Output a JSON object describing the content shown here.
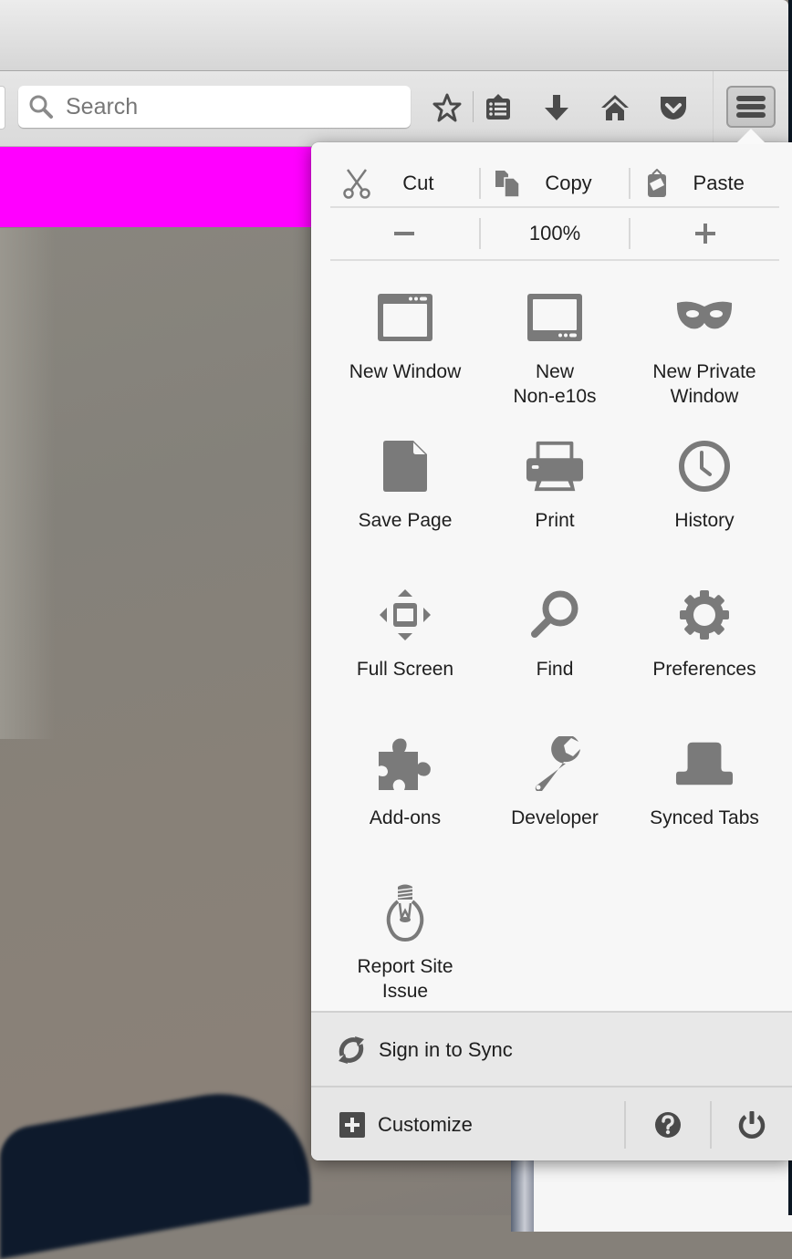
{
  "colors": {
    "icon_gray": "#7a7a7a",
    "icon_dark": "#4a4a4a",
    "page_banner": "#ff00ff"
  },
  "toolbar": {
    "search": {
      "placeholder": "Search",
      "value": "",
      "icon": "search-icon"
    },
    "buttons": [
      {
        "name": "bookmark",
        "icon": "star-icon"
      },
      {
        "name": "bookmarks-menu",
        "icon": "bookmarks-list-icon"
      },
      {
        "name": "downloads",
        "icon": "download-arrow-icon"
      },
      {
        "name": "home",
        "icon": "home-icon"
      },
      {
        "name": "pocket",
        "icon": "pocket-icon"
      },
      {
        "name": "open-menu",
        "icon": "hamburger-icon",
        "active": true
      }
    ]
  },
  "panel": {
    "edit": [
      {
        "label": "Cut",
        "icon": "scissors-icon"
      },
      {
        "label": "Copy",
        "icon": "copy-icon"
      },
      {
        "label": "Paste",
        "icon": "paste-icon"
      }
    ],
    "zoom": {
      "out_icon": "minus-icon",
      "level": "100%",
      "in_icon": "plus-icon"
    },
    "items": [
      {
        "label": "New Window",
        "icon": "new-window-icon"
      },
      {
        "label": "New\nNon-e10s",
        "icon": "non-e10s-window-icon"
      },
      {
        "label": "New Private\nWindow",
        "icon": "private-mask-icon"
      },
      {
        "label": "Save Page",
        "icon": "save-page-icon"
      },
      {
        "label": "Print",
        "icon": "printer-icon"
      },
      {
        "label": "History",
        "icon": "clock-icon"
      },
      {
        "label": "Full Screen",
        "icon": "fullscreen-icon"
      },
      {
        "label": "Find",
        "icon": "magnifier-icon"
      },
      {
        "label": "Preferences",
        "icon": "gear-icon"
      },
      {
        "label": "Add-ons",
        "icon": "puzzle-icon"
      },
      {
        "label": "Developer",
        "icon": "wrench-icon"
      },
      {
        "label": "Synced Tabs",
        "icon": "synced-tabs-icon"
      },
      {
        "label": "Report Site\nIssue",
        "icon": "lightbulb-icon"
      }
    ],
    "sync": {
      "label": "Sign in to Sync",
      "icon": "sync-icon"
    },
    "footer": {
      "customize_label": "Customize",
      "customize_icon": "plus-square-icon",
      "help_icon": "help-icon",
      "quit_icon": "power-icon"
    }
  }
}
